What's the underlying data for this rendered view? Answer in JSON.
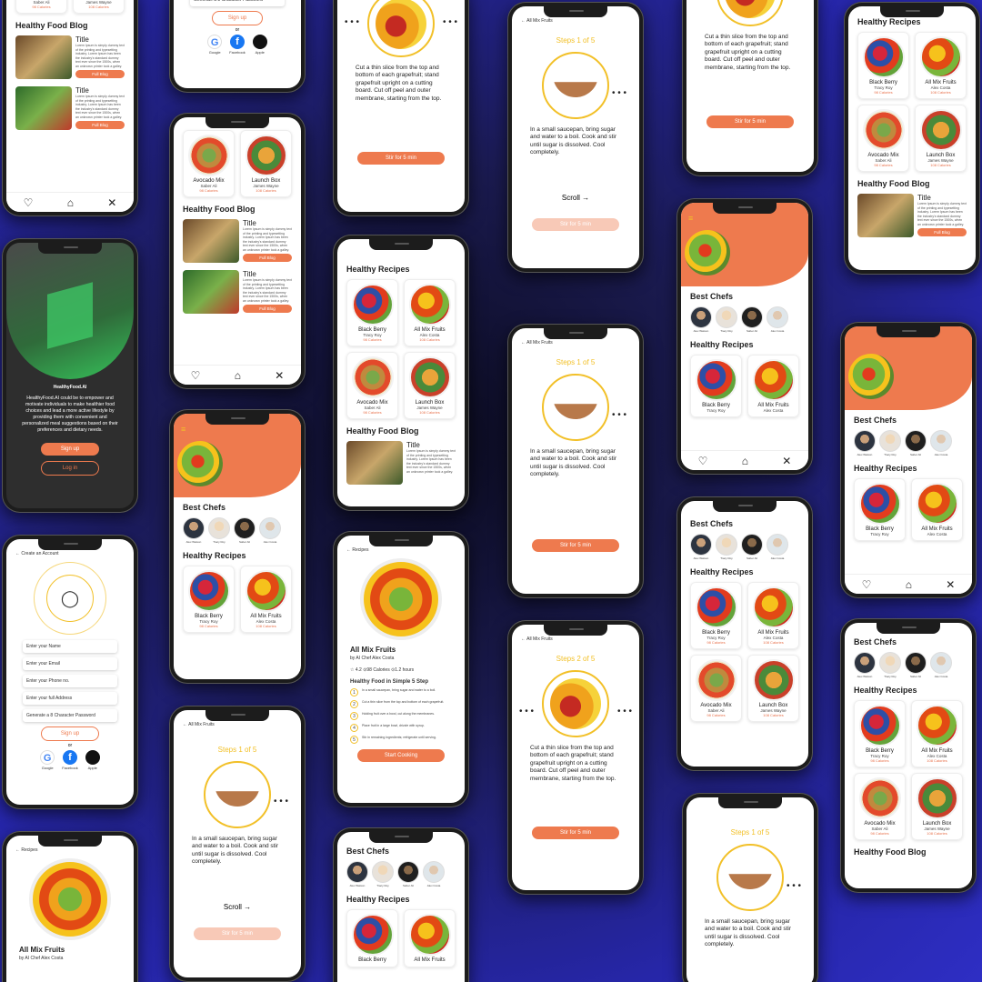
{
  "recipes": [
    {
      "name": "Black Berry",
      "author": "Tracy Roy",
      "cal": "98 Calories"
    },
    {
      "name": "All Mix Fruits",
      "author": "Alex Costa",
      "cal": "108 Calories"
    },
    {
      "name": "Avocado Mix",
      "author": "Saber Ali",
      "cal": "98 Calories"
    },
    {
      "name": "Launch Box",
      "author": "James Wayne",
      "cal": "108 Calories"
    }
  ],
  "labels": {
    "healthy_recipes": "Healthy Recipes",
    "best_chefs": "Best Chefs",
    "healthy_blog": "Healthy Food Blog",
    "blog_title": "Title",
    "blog_text": "Lorem Ipsum is simply dummy text of the printing and typesetting industry. Lorem Ipsum has been the industry's standard dummy text ever since the 1500s, when an unknown printer took a galley.",
    "full_blog": "Full Blog",
    "step1": "Steps 1 of 5",
    "step2": "Steps 2 of 5",
    "step1_text": "In a small saucepan, bring sugar and water to a boil. Cook and stir until sugar is dissolved. Cool completely.",
    "step2_text": "Cut a thin slice from the top and bottom of each grapefruit; stand grapefruit upright on a cutting board. Cut off peel and outer membrane, starting from the top.",
    "stir": "Stir for 5 min",
    "scroll": "Scroll →",
    "dots": "• • •",
    "all_mix": "All Mix Fruits",
    "back_all_mix": "← All Mix Fruits",
    "back_recipes": "← Recipes",
    "back_create": "← Create an Account",
    "by": "by  AI Chef Alex Costa",
    "rating_meta": "☆ 4.2     ⊙98 Calories     ⊙1.2 hours",
    "simple_steps": "Healthy Food in Simple 5 Step",
    "start_cooking": "Start Cooking",
    "brand": "HealthyFood.AI",
    "onboard_text": "HealthyFood.AI could be to empower and motivate individuals to make healthier food choices and lead a more active lifestyle by providing them with convenient and personalized meal suggestions based on their preferences and dietary needs.",
    "sign_up": "Sign up",
    "log_in": "Log in",
    "or": "or",
    "field_name": "Enter your Name",
    "field_email": "Enter your Email",
    "field_phone": "Enter your Phone no.",
    "field_address": "Enter your full Address",
    "field_password": "Generate a 8 Character Password"
  },
  "chefs": [
    {
      "name": "Alex Watson"
    },
    {
      "name": "Tracy Roy"
    },
    {
      "name": "Saber Ali"
    },
    {
      "name": "Alex Costa"
    }
  ],
  "social": [
    {
      "name": "Google",
      "letter": "G",
      "color": "#4285f4"
    },
    {
      "name": "Facebook",
      "letter": "f",
      "color": "#1877f2"
    },
    {
      "name": "Apple",
      "letter": "",
      "color": "#111111"
    }
  ],
  "steps_list": [
    {
      "n": "1",
      "text": "In a small saucepan, bring sugar and water to a boil."
    },
    {
      "n": "2",
      "text": "Cut a thin slice from the top and bottom of each grapefruit."
    },
    {
      "n": "3",
      "text": "Holding fruit over a bowl, cut along the membranes."
    },
    {
      "n": "4",
      "text": "Place fruit in a large bowl, drizzle with syrup."
    },
    {
      "n": "5",
      "text": "Stir in remaining ingredients; refrigerate until serving."
    }
  ],
  "colors": {
    "accent": "#ee7a4e",
    "step": "#f2c028",
    "background": "#2626a8"
  },
  "icons": [
    "heart-icon",
    "home-icon",
    "utensils-icon",
    "menu-icon",
    "user-icon",
    "back-arrow-icon"
  ]
}
